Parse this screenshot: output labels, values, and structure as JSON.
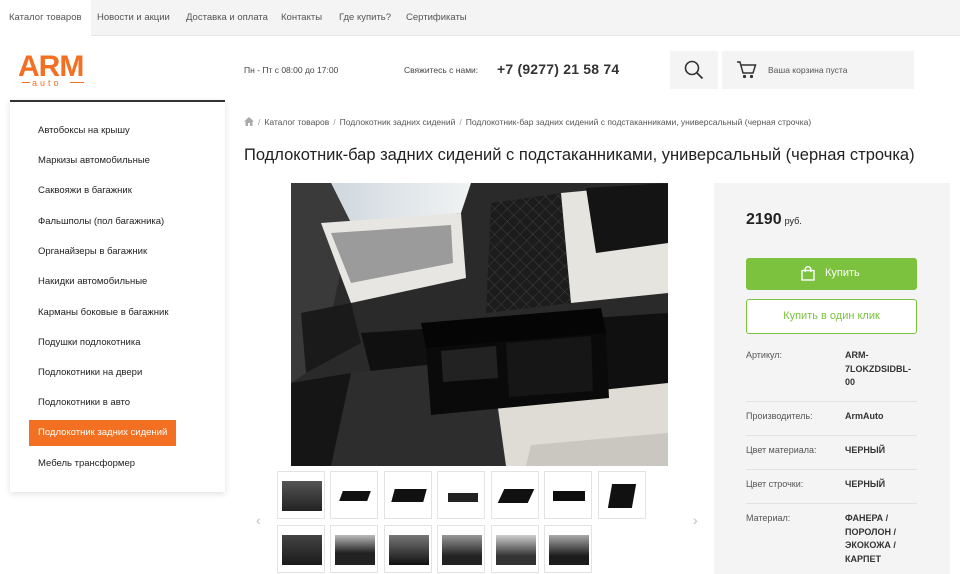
{
  "topnav": {
    "items": [
      "Каталог товаров",
      "Новости и акции",
      "Доставка и оплата",
      "Контакты",
      "Где купить?",
      "Сертификаты"
    ]
  },
  "header": {
    "logo_main": "ARM",
    "logo_sub": "auto",
    "hours": "Пн - Пт с 08:00 до 17:00",
    "contact_label": "Свяжитесь с нами:",
    "phone": "+7 (9277) 21 58 74",
    "cart_text": "Ваша корзина пуста",
    "icons": {
      "search": "search-icon",
      "cart": "cart-icon"
    }
  },
  "sidebar": {
    "items": [
      "Автобоксы на крышу",
      "Маркизы автомобильные",
      "Саквояжи в багажник",
      "Фальшполы (пол багажника)",
      "Органайзеры в багажник",
      "Накидки автомобильные",
      "Карманы боковые в багажник",
      "Подушки подлокотника",
      "Подлокотники на двери",
      "Подлокотники в авто",
      "Подлокотник задних сидений",
      "Мебель трансформер"
    ],
    "active_index": 10
  },
  "breadcrumb": [
    "Каталог товаров",
    "Подлокотник задних сидений",
    "Подлокотник-бар задних сидений с подстаканниками, универсальный (черная строчка)"
  ],
  "product": {
    "title": "Подлокотник-бар задних сидений с подстаканниками, универсальный (черная строчка)",
    "price": "2190",
    "currency": "руб.",
    "buy_label": "Купить",
    "one_click_label": "Купить в один клик",
    "specs": [
      {
        "label": "Артикул:",
        "value": [
          "ARM-",
          "7LOKZDSIDBL-",
          "00"
        ]
      },
      {
        "label": "Производитель:",
        "value": [
          "ArmAuto"
        ]
      },
      {
        "label": "Цвет материала:",
        "value": [
          "ЧЕРНЫЙ"
        ]
      },
      {
        "label": "Цвет строчки:",
        "value": [
          "ЧЕРНЫЙ"
        ]
      },
      {
        "label": "Материал:",
        "value": [
          "ФАНЕРА /",
          "ПОРОЛОН /",
          "ЭКОКОЖА /",
          "КАРПЕТ"
        ]
      }
    ]
  },
  "gallery": {
    "thumbnail_count": 13,
    "prev_icon": "chevron-left-icon",
    "next_icon": "chevron-right-icon",
    "prev_glyph": "‹",
    "next_glyph": "›"
  },
  "colors": {
    "accent": "#f36f21",
    "buy_green": "#7cc23f",
    "panel_bg": "#f4f4f4"
  }
}
